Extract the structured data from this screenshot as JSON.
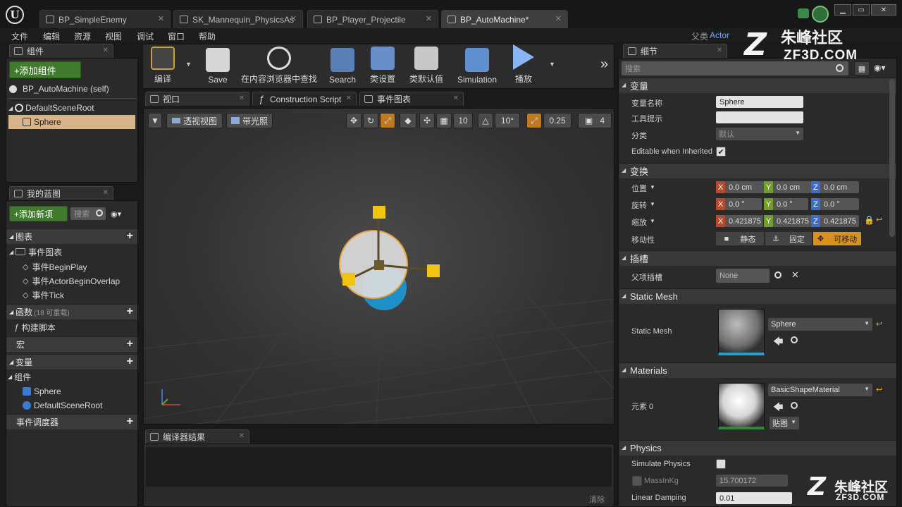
{
  "tabs": [
    {
      "label": "BP_SimpleEnemy"
    },
    {
      "label": "SK_Mannequin_PhysicsAs"
    },
    {
      "label": "BP_Player_Projectile"
    },
    {
      "label": "BP_AutoMachine*"
    }
  ],
  "menu": [
    "文件",
    "编辑",
    "资源",
    "视图",
    "调试",
    "窗口",
    "帮助"
  ],
  "parent_class": {
    "label": "父类",
    "value": "Actor"
  },
  "components": {
    "tab_label": "组件",
    "add_button": "+添加组件",
    "self_item": "BP_AutoMachine (self)",
    "root_item": "DefaultSceneRoot",
    "child_item": "Sphere"
  },
  "toolbar": {
    "compile": "编译",
    "save": "Save",
    "browse": "在内容浏览器中查找",
    "search": "Search",
    "class_settings": "类设置",
    "class_defaults": "类默认值",
    "simulation": "Simulation",
    "play": "播放"
  },
  "editor_tabs": {
    "viewport": "视口",
    "construction": "Construction Script",
    "event_graph": "事件图表"
  },
  "viewport": {
    "perspective": "透视视图",
    "lit": "带光照",
    "grid_snap": "10",
    "rot_snap": "10°",
    "scale_snap": "0.25",
    "camera_speed": "4"
  },
  "my_blueprint": {
    "tab_label": "我的蓝图",
    "add_new": "+添加新项",
    "search_placeholder": "搜索",
    "graphs": "图表",
    "event_graph": "事件图表",
    "events": [
      "事件BeginPlay",
      "事件ActorBeginOverlap",
      "事件Tick"
    ],
    "functions": "函数",
    "functions_note": "(18 可重载)",
    "construction_script": "构建脚本",
    "macros": "宏",
    "variables": "变量",
    "components_group": "组件",
    "var_components": [
      "Sphere",
      "DefaultSceneRoot"
    ],
    "event_dispatchers": "事件调度器"
  },
  "compiler": {
    "tab_label": "编译器结果",
    "clear": "清除"
  },
  "details": {
    "tab_label": "细节",
    "search_placeholder": "搜索",
    "variable_section": "变量",
    "var_name_label": "变量名称",
    "var_name_value": "Sphere",
    "tooltip_label": "工具提示",
    "category_label": "分类",
    "category_value": "默认",
    "editable_label": "Editable when Inherited",
    "transform_section": "变换",
    "location_label": "位置",
    "location": [
      "0.0 cm",
      "0.0 cm",
      "0.0 cm"
    ],
    "rotation_label": "旋转",
    "rotation": [
      "0.0 °",
      "0.0 °",
      "0.0 °"
    ],
    "scale_label": "缩放",
    "scale": [
      "0.421875",
      "0.421875",
      "0.421875"
    ],
    "mobility_label": "移动性",
    "mobility": [
      "静态",
      "固定",
      "可移动"
    ],
    "socket_section": "插槽",
    "parent_socket_label": "父项插槽",
    "parent_socket_value": "None",
    "static_mesh_section": "Static Mesh",
    "static_mesh_label": "Static Mesh",
    "static_mesh_value": "Sphere",
    "materials_section": "Materials",
    "element_label": "元素 0",
    "material_value": "BasicShapeMaterial",
    "texture_button": "贴图",
    "physics_section": "Physics",
    "simulate_label": "Simulate Physics",
    "mass_label": "MassInKg",
    "mass_value": "15.700172",
    "damping_label": "Linear Damping",
    "damping_value": "0.01"
  },
  "watermark": {
    "brand": "朱峰社区",
    "url": "ZF3D.COM"
  },
  "colors": {
    "accent_green": "#3f7a2d",
    "selection": "#d8b48a",
    "axis_x": "#b6492c",
    "axis_y": "#6f9e2a",
    "axis_z": "#3b6fc8",
    "movable": "#d9901f"
  }
}
